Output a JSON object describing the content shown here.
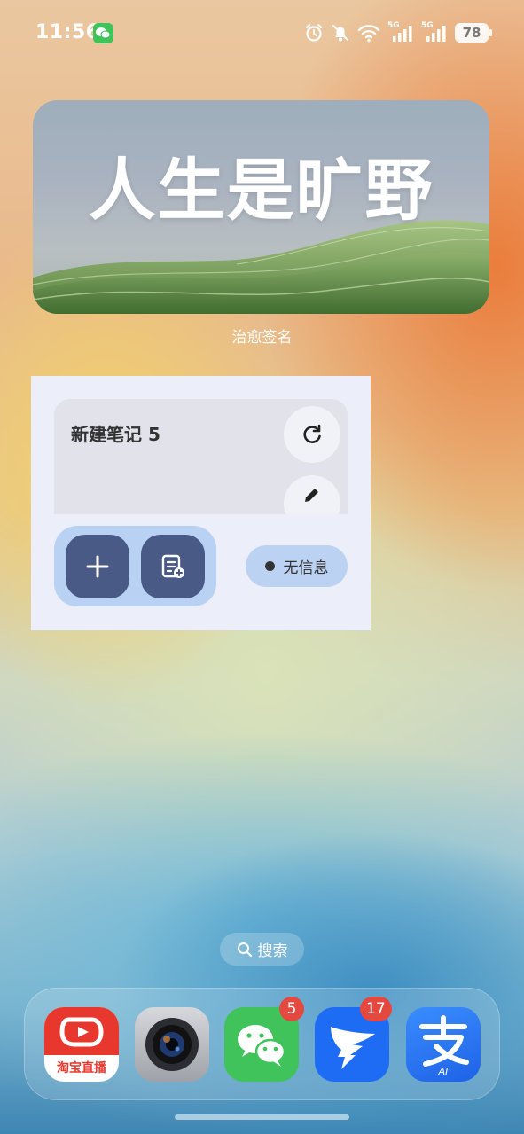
{
  "status_bar": {
    "time": "11:56",
    "battery": "78",
    "signal_label_1": "5G",
    "signal_label_2": "5G",
    "icons": [
      "wechat-icon",
      "alarm-icon",
      "mute-bell-icon",
      "wifi-icon",
      "signal-icon",
      "signal-icon",
      "battery-icon"
    ]
  },
  "banner_widget": {
    "title": "人生是旷野",
    "label": "治愈签名"
  },
  "notes_widget": {
    "note_title": "新建笔记 5",
    "status": "无信息",
    "icons": [
      "refresh-icon",
      "edit-icon",
      "plus-icon",
      "new-note-icon"
    ]
  },
  "search": {
    "label": "搜索"
  },
  "dock": {
    "apps": [
      {
        "name": "taobao-live",
        "label": "淘宝直播",
        "color": "#e8382e"
      },
      {
        "name": "camera",
        "color": "#b9bcc2"
      },
      {
        "name": "wechat",
        "badge": "5",
        "color": "#3fc35a"
      },
      {
        "name": "dingtalk",
        "badge": "17",
        "color": "#1f6cf4"
      },
      {
        "name": "alipay",
        "label": "AI",
        "color": "#2a7af5"
      }
    ]
  }
}
